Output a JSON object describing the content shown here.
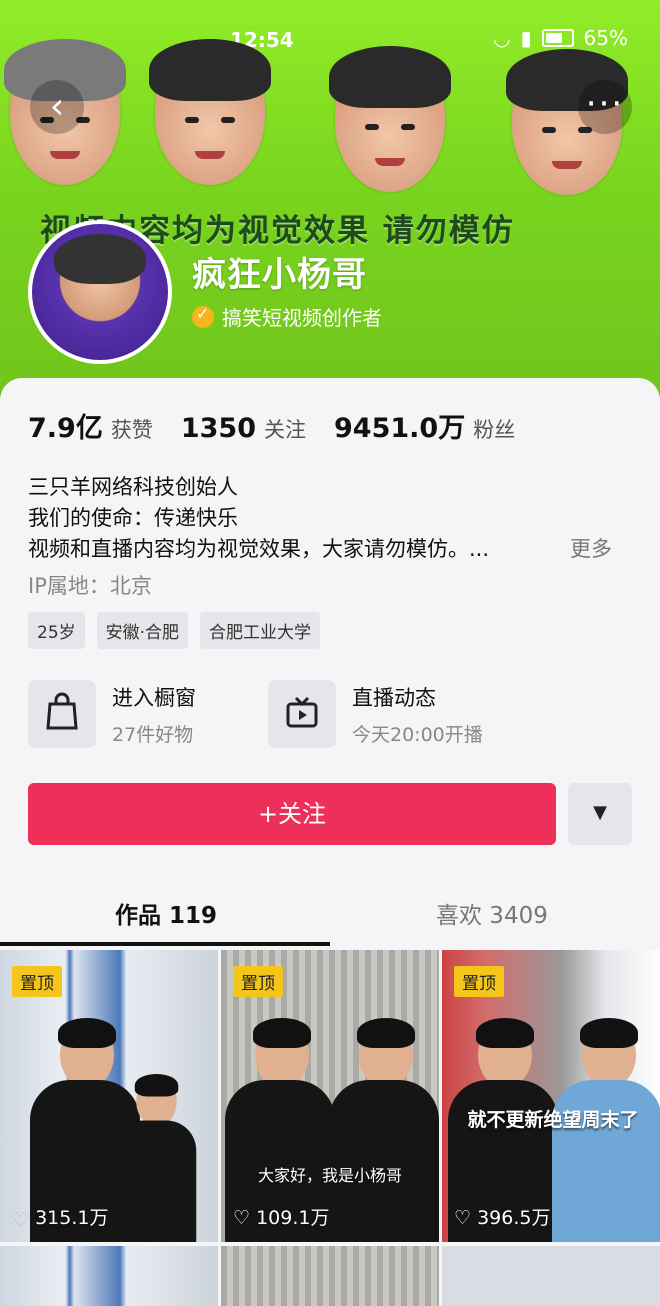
{
  "status_bar": {
    "time": "12:54",
    "battery": "65%"
  },
  "header": {
    "banner_text": "视频内容均为视觉效果 请勿模仿",
    "name": "疯狂小杨哥",
    "verification": "搞笑短视频创作者",
    "back_icon": "chevron-left-icon",
    "more_icon": "more-icon"
  },
  "stats": [
    {
      "value": "7.9亿",
      "label": "获赞"
    },
    {
      "value": "1350",
      "label": "关注"
    },
    {
      "value": "9451.0万",
      "label": "粉丝"
    }
  ],
  "bio": {
    "line1": "三只羊网络科技创始人",
    "line2": "我们的使命：传递快乐",
    "line3": "视频和直播内容均为视觉效果，大家请勿模仿。...",
    "more": "更多",
    "ip": "IP属地：北京"
  },
  "tags": [
    "25岁",
    "安徽·合肥",
    "合肥工业大学"
  ],
  "features": {
    "shop": {
      "title": "进入橱窗",
      "subtitle": "27件好物",
      "icon": "shopping-bag-icon"
    },
    "live": {
      "title": "直播动态",
      "subtitle": "今天20:00开播",
      "icon": "tv-icon"
    }
  },
  "actions": {
    "follow_label": "+关注",
    "dropdown_icon": "triangle-down-icon"
  },
  "tabs": [
    {
      "label": "作品 119",
      "active": true
    },
    {
      "label": "喜欢 3409",
      "active": false
    }
  ],
  "videos": [
    {
      "pinned": "置顶",
      "likes": "315.1万",
      "caption": ""
    },
    {
      "pinned": "置顶",
      "likes": "109.1万",
      "caption": "大家好，我是小杨哥"
    },
    {
      "pinned": "置顶",
      "likes": "396.5万",
      "caption": "就不更新绝望周末了"
    }
  ]
}
